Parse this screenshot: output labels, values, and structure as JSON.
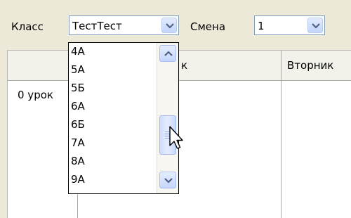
{
  "toolbar": {
    "class_label": "Класс",
    "class_value": "ТестТест",
    "shift_label": "Смена",
    "shift_value": "1"
  },
  "grid": {
    "col_header_partial": "к",
    "col_header_tuesday": "Вторник",
    "row_label": "0 урок"
  },
  "dropdown": {
    "options": [
      "4А",
      "5А",
      "5Б",
      "6А",
      "6Б",
      "7А",
      "8А",
      "9А"
    ]
  },
  "colors": {
    "window_bg": "#ece9d8",
    "field_border": "#7f9db9",
    "scroll_button": "#c3d5fb",
    "arrow": "#4d6185"
  },
  "icons": [
    "chevron-down-icon",
    "chevron-up-icon",
    "scrollbar-grip-icon",
    "mouse-pointer-icon"
  ]
}
